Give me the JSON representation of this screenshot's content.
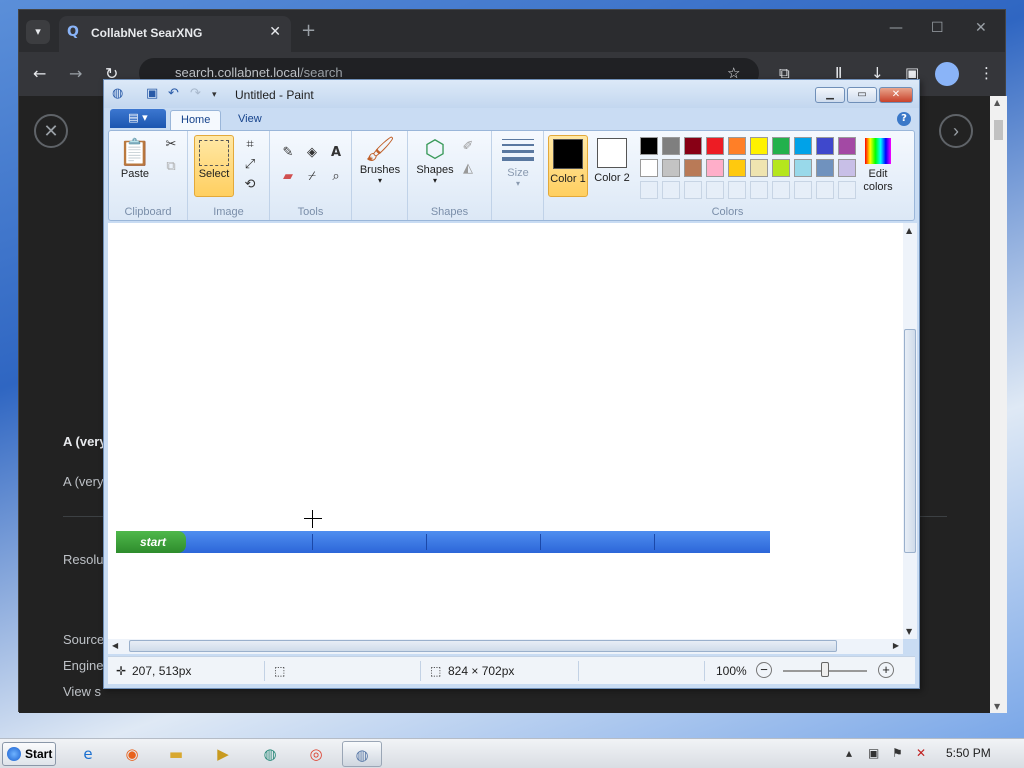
{
  "browser": {
    "tab_title": "CollabNet SearXNG",
    "tab_close": "✕",
    "new_tab": "+",
    "url_host": "search.collabnet.local",
    "url_path": "/search",
    "result": {
      "title": "A (very",
      "snippet": "A (very",
      "resolution_label": "Resolu",
      "source_label": "Source",
      "engine_label": "Engine",
      "view_label": "View s"
    }
  },
  "paint": {
    "window_title": "Untitled - Paint",
    "app_menu": "▤ ▾",
    "tabs": [
      {
        "label": "Home"
      },
      {
        "label": "View"
      }
    ],
    "groups": {
      "clipboard": "Clipboard",
      "image": "Image",
      "tools": "Tools",
      "shapes": "Shapes",
      "colors": "Colors"
    },
    "buttons": {
      "paste": "Paste",
      "select": "Select",
      "brushes": "Brushes",
      "shapes": "Shapes",
      "size": "Size",
      "color1": "Color 1",
      "color2": "Color 2",
      "edit_colors": "Edit colors"
    },
    "color1_value": "#000000",
    "color2_value": "#ffffff",
    "palette_row1": [
      "#000000",
      "#7f7f7f",
      "#880015",
      "#ed1c24",
      "#ff7f27",
      "#fff200",
      "#22b14c",
      "#00a2e8",
      "#3f48cc",
      "#a349a4"
    ],
    "palette_row2": [
      "#ffffff",
      "#c3c3c3",
      "#b97a57",
      "#ffaec9",
      "#ffc90e",
      "#efe4b0",
      "#b5e61d",
      "#99d9ea",
      "#7092be",
      "#c8bfe7"
    ],
    "status": {
      "cursor_pos": "207, 513px",
      "image_size": "824 × 702px",
      "zoom": "100%"
    },
    "canvas_strip_label": "start"
  },
  "taskbar": {
    "start_label": "Start",
    "clock": "5:50 PM"
  }
}
